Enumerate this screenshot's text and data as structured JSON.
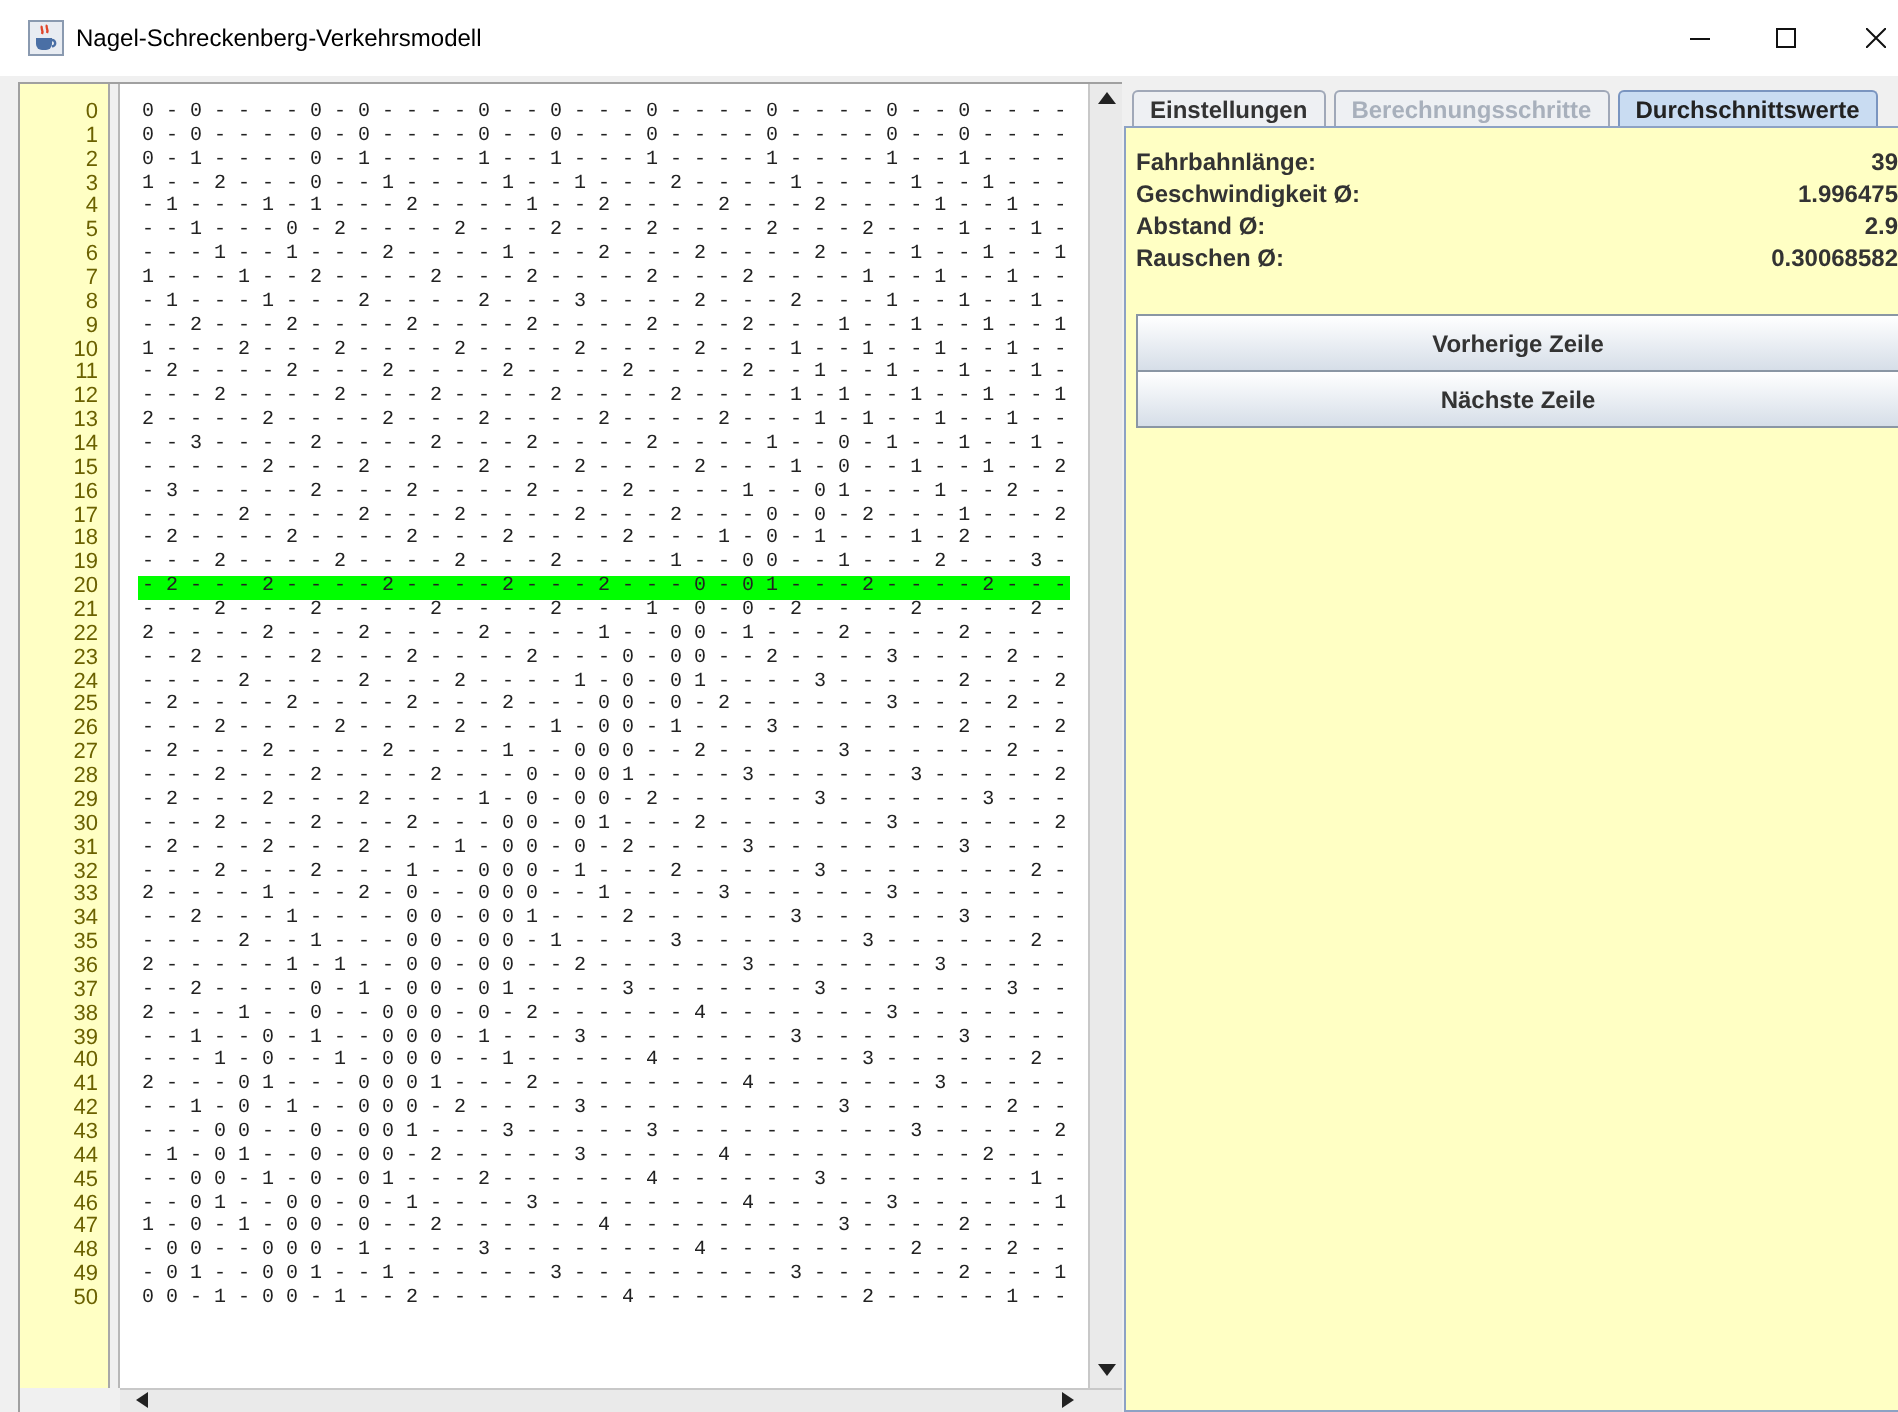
{
  "window": {
    "title": "Nagel-Schreckenberg-Verkehrsmodell"
  },
  "road": {
    "rows": [
      {
        "number": "0",
        "cells": "0 - 0 - - - - 0 - 0 - - - - 0 - - 0 - - - 0 - - - - 0 - - - - 0 - - 0 - - - -",
        "selected": false
      },
      {
        "number": "1",
        "cells": "0 - 0 - - - - 0 - 0 - - - - 0 - - 0 - - - 0 - - - - 0 - - - - 0 - - 0 - - - -",
        "selected": false
      },
      {
        "number": "2",
        "cells": "0 - 1 - - - - 0 - 1 - - - - 1 - - 1 - - - 1 - - - - 1 - - - - 1 - - 1 - - - -",
        "selected": false
      },
      {
        "number": "3",
        "cells": "1 - - 2 - - - 0 - - 1 - - - - 1 - - 1 - - - 2 - - - - 1 - - - - 1 - - 1 - - -",
        "selected": false
      },
      {
        "number": "4",
        "cells": "- 1 - - - 1 - 1 - - - 2 - - - - 1 - - 2 - - - - 2 - - - 2 - - - - 1 - - 1 - -",
        "selected": false
      },
      {
        "number": "5",
        "cells": "- - 1 - - - 0 - 2 - - - - 2 - - - 2 - - - 2 - - - - 2 - - - 2 - - - 1 - - 1 -",
        "selected": false
      },
      {
        "number": "6",
        "cells": "- - - 1 - - 1 - - - 2 - - - - 1 - - - 2 - - - 2 - - - - 2 - - - 1 - - 1 - - 1",
        "selected": false
      },
      {
        "number": "7",
        "cells": "1 - - - 1 - - 2 - - - - 2 - - - 2 - - - - 2 - - - 2 - - - - 1 - - 1 - - 1 - -",
        "selected": false
      },
      {
        "number": "8",
        "cells": "- 1 - - - 1 - - - 2 - - - - 2 - - - 3 - - - - 2 - - - 2 - - - 1 - - 1 - - 1 -",
        "selected": false
      },
      {
        "number": "9",
        "cells": "- - 2 - - - 2 - - - - 2 - - - - 2 - - - - 2 - - - 2 - - - 1 - - 1 - - 1 - - 1",
        "selected": false
      },
      {
        "number": "10",
        "cells": "1 - - - 2 - - - 2 - - - - 2 - - - - 2 - - - - 2 - - - 1 - - 1 - - 1 - - 1 - -",
        "selected": false
      },
      {
        "number": "11",
        "cells": "- 2 - - - - 2 - - - 2 - - - - 2 - - - - 2 - - - - 2 - - 1 - - 1 - - 1 - - 1 -",
        "selected": false
      },
      {
        "number": "12",
        "cells": "- - - 2 - - - - 2 - - - 2 - - - - 2 - - - - 2 - - - - 1 - 1 - - 1 - - 1 - - 1",
        "selected": false
      },
      {
        "number": "13",
        "cells": "2 - - - - 2 - - - - 2 - - - 2 - - - - 2 - - - - 2 - - - 1 - 1 - - 1 - - 1 - -",
        "selected": false
      },
      {
        "number": "14",
        "cells": "- - 3 - - - - 2 - - - - 2 - - - 2 - - - - 2 - - - - 1 - - 0 - 1 - - 1 - - 1 -",
        "selected": false
      },
      {
        "number": "15",
        "cells": "- - - - - 2 - - - 2 - - - - 2 - - - 2 - - - - 2 - - - 1 - 0 - - 1 - - 1 - - 2",
        "selected": false
      },
      {
        "number": "16",
        "cells": "- 3 - - - - - 2 - - - 2 - - - - 2 - - - 2 - - - - 1 - - 0 1 - - - 1 - - 2 - -",
        "selected": false
      },
      {
        "number": "17",
        "cells": "- - - - 2 - - - - 2 - - - 2 - - - - 2 - - - 2 - - - 0 - 0 - 2 - - - 1 - - - 2",
        "selected": false
      },
      {
        "number": "18",
        "cells": "- 2 - - - - 2 - - - - 2 - - - 2 - - - - 2 - - - 1 - 0 - 1 - - - 1 - 2 - - - -",
        "selected": false
      },
      {
        "number": "19",
        "cells": "- - - 2 - - - - 2 - - - - 2 - - - 2 - - - - 1 - - 0 0 - - 1 - - - 2 - - - 3 -",
        "selected": false
      },
      {
        "number": "20",
        "cells": "- 2 - - - 2 - - - - 2 - - - - 2 - - - 2 - - - 0 - 0 1 - - - 2 - - - - 2 - - -",
        "selected": true
      },
      {
        "number": "21",
        "cells": "- - - 2 - - - 2 - - - - 2 - - - - 2 - - - 1 - 0 - 0 - 2 - - - - 2 - - - - 2 -",
        "selected": false
      },
      {
        "number": "22",
        "cells": "2 - - - - 2 - - - 2 - - - - 2 - - - - 1 - - 0 0 - 1 - - - 2 - - - - 2 - - - -",
        "selected": false
      },
      {
        "number": "23",
        "cells": "- - 2 - - - - 2 - - - 2 - - - - 2 - - - 0 - 0 0 - - 2 - - - - 3 - - - - 2 - -",
        "selected": false
      },
      {
        "number": "24",
        "cells": "- - - - 2 - - - - 2 - - - 2 - - - - 1 - 0 - 0 1 - - - - 3 - - - - - 2 - - - 2",
        "selected": false
      },
      {
        "number": "25",
        "cells": "- 2 - - - - 2 - - - - 2 - - - 2 - - - 0 0 - 0 - 2 - - - - - - 3 - - - - 2 - -",
        "selected": false
      },
      {
        "number": "26",
        "cells": "- - - 2 - - - - 2 - - - - 2 - - - 1 - 0 0 - 1 - - - 3 - - - - - - - 2 - - - 2",
        "selected": false
      },
      {
        "number": "27",
        "cells": "- 2 - - - 2 - - - - 2 - - - - 1 - - 0 0 0 - - 2 - - - - - 3 - - - - - - 2 - -",
        "selected": false
      },
      {
        "number": "28",
        "cells": "- - - 2 - - - 2 - - - - 2 - - - 0 - 0 0 1 - - - - 3 - - - - - - 3 - - - - - 2",
        "selected": false
      },
      {
        "number": "29",
        "cells": "- 2 - - - 2 - - - 2 - - - - 1 - 0 - 0 0 - 2 - - - - - - 3 - - - - - - 3 - - -",
        "selected": false
      },
      {
        "number": "30",
        "cells": "- - - 2 - - - 2 - - - 2 - - - 0 0 - 0 1 - - - 2 - - - - - - - 3 - - - - - - 2",
        "selected": false
      },
      {
        "number": "31",
        "cells": "- 2 - - - 2 - - - 2 - - - 1 - 0 0 - 0 - 2 - - - - 3 - - - - - - - - 3 - - - -",
        "selected": false
      },
      {
        "number": "32",
        "cells": "- - - 2 - - - 2 - - - 1 - - 0 0 0 - 1 - - - 2 - - - - - 3 - - - - - - - - 2 -",
        "selected": false
      },
      {
        "number": "33",
        "cells": "2 - - - - 1 - - - 2 - 0 - - 0 0 0 - - 1 - - - - 3 - - - - - - 3 - - - - - - -",
        "selected": false
      },
      {
        "number": "34",
        "cells": "- - 2 - - - 1 - - - - 0 0 - 0 0 1 - - - 2 - - - - - - 3 - - - - - - 3 - - - -",
        "selected": false
      },
      {
        "number": "35",
        "cells": "- - - - 2 - - 1 - - - 0 0 - 0 0 - 1 - - - - 3 - - - - - - - 3 - - - - - - 2 -",
        "selected": false
      },
      {
        "number": "36",
        "cells": "2 - - - - - 1 - 1 - - 0 0 - 0 0 - - 2 - - - - - - 3 - - - - - - - 3 - - - - -",
        "selected": false
      },
      {
        "number": "37",
        "cells": "- - 2 - - - - 0 - 1 - 0 0 - 0 1 - - - - 3 - - - - - - - 3 - - - - - - - 3 - -",
        "selected": false
      },
      {
        "number": "38",
        "cells": "2 - - - 1 - - 0 - - 0 0 0 - 0 - 2 - - - - - - 4 - - - - - - - 3 - - - - - - -",
        "selected": false
      },
      {
        "number": "39",
        "cells": "- - 1 - - 0 - 1 - - 0 0 0 - 1 - - - 3 - - - - - - - - 3 - - - - - - 3 - - - -",
        "selected": false
      },
      {
        "number": "40",
        "cells": "- - - 1 - 0 - - 1 - 0 0 0 - - 1 - - - - - 4 - - - - - - - - 3 - - - - - - 2 -",
        "selected": false
      },
      {
        "number": "41",
        "cells": "2 - - - 0 1 - - - 0 0 0 1 - - - 2 - - - - - - - - 4 - - - - - - - 3 - - - - -",
        "selected": false
      },
      {
        "number": "42",
        "cells": "- - 1 - 0 - 1 - - 0 0 0 - 2 - - - - 3 - - - - - - - - - - 3 - - - - - - 2 - -",
        "selected": false
      },
      {
        "number": "43",
        "cells": "- - - 0 0 - - 0 - 0 0 1 - - - 3 - - - - - 3 - - - - - - - - - - 3 - - - - - 2",
        "selected": false
      },
      {
        "number": "44",
        "cells": "- 1 - 0 1 - - 0 - 0 0 - 2 - - - - - 3 - - - - - 4 - - - - - - - - - - 2 - - -",
        "selected": false
      },
      {
        "number": "45",
        "cells": "- - 0 0 - 1 - 0 - 0 1 - - - 2 - - - - - - 4 - - - - - - 3 - - - - - - - - 1 -",
        "selected": false
      },
      {
        "number": "46",
        "cells": "- - 0 1 - - 0 0 - 0 - 1 - - - - 3 - - - - - - - - 4 - - - - - 3 - - - - - - 1",
        "selected": false
      },
      {
        "number": "47",
        "cells": "1 - 0 - 1 - 0 0 - 0 - - 2 - - - - - - 4 - - - - - - - - - 3 - - - - 2 - - - -",
        "selected": false
      },
      {
        "number": "48",
        "cells": "- 0 0 - - 0 0 0 - 1 - - - - 3 - - - - - - - - 4 - - - - - - - - 2 - - - 2 - -",
        "selected": false
      },
      {
        "number": "49",
        "cells": "- 0 1 - - 0 0 1 - - 1 - - - - - - 3 - - - - - - - - - 3 - - - - - - 2 - - - 1",
        "selected": false
      },
      {
        "number": "50",
        "cells": "0 0 - 1 - 0 0 - 1 - - 2 - - - - - - - - 4 - - - - - - - - - 2 - - - - - 1 - -",
        "selected": false
      }
    ]
  },
  "tabs": [
    {
      "label": "Einstellungen",
      "selected": false,
      "disabled": false
    },
    {
      "label": "Berechnungsschritte",
      "selected": false,
      "disabled": true
    },
    {
      "label": "Durchschnittswerte",
      "selected": true,
      "disabled": false
    }
  ],
  "averages": [
    {
      "label": "Fahrbahnlänge:",
      "value": "39"
    },
    {
      "label": "Geschwindigkeit Ø:",
      "value": "1.996475"
    },
    {
      "label": "Abstand Ø:",
      "value": "2.9"
    },
    {
      "label": "Rauschen Ø:",
      "value": "0.30068582"
    }
  ],
  "buttons": [
    "Vorherige Zeile",
    "Nächste Zeile"
  ]
}
